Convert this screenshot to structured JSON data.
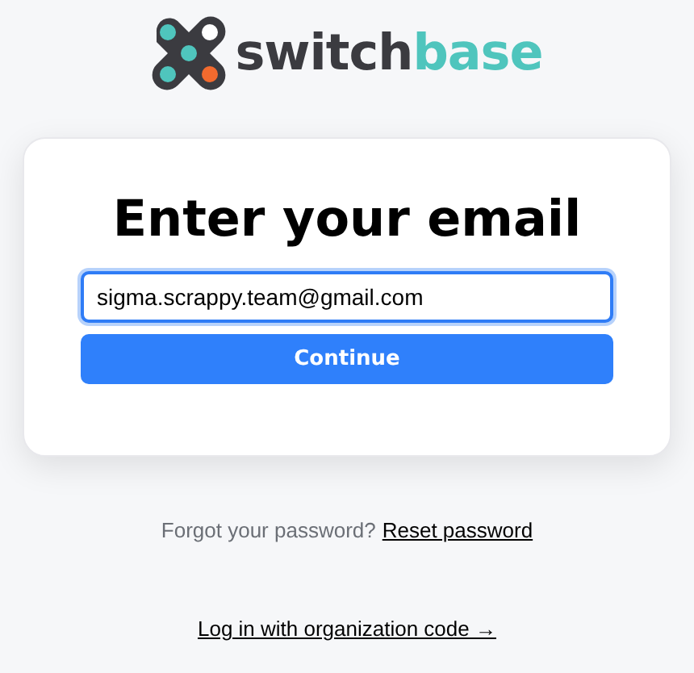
{
  "logo": {
    "word_dark": "switch",
    "word_accent": "base"
  },
  "card": {
    "title": "Enter your email",
    "email_field": {
      "value": "sigma.scrappy.team@gmail.com",
      "focused": true
    },
    "button": "Continue"
  },
  "forgot": {
    "text": "Forgot your password?",
    "link": "Reset password"
  },
  "org_link": "Log in with organization code →"
}
